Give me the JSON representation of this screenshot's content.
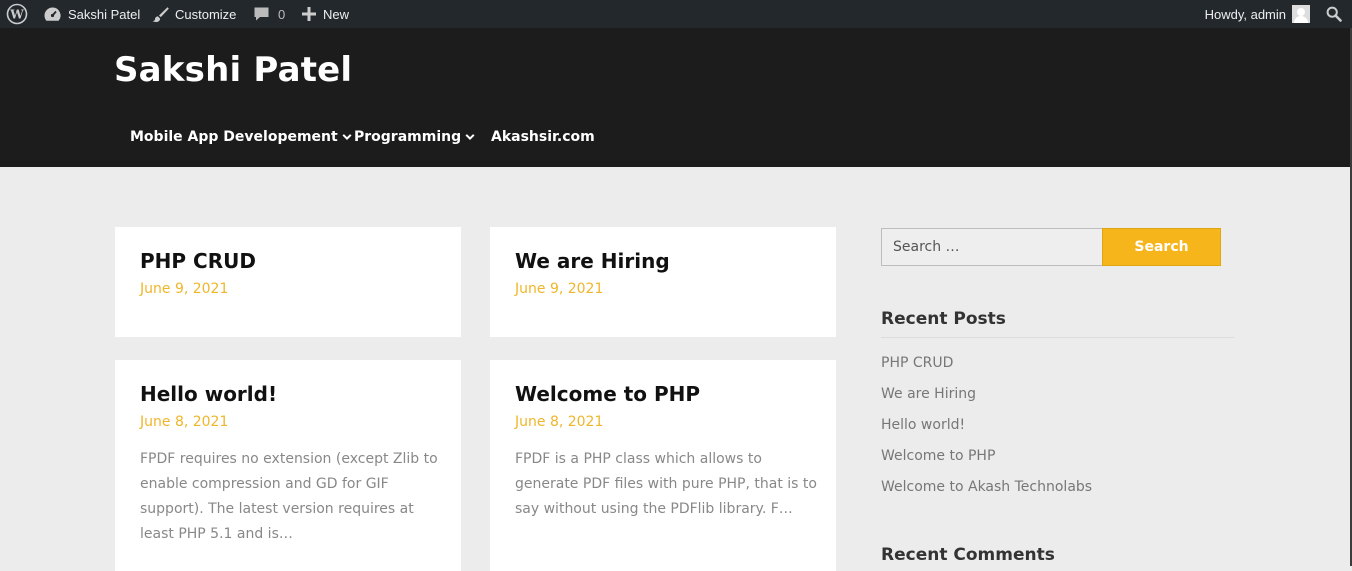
{
  "admin_bar": {
    "site_name": "Sakshi Patel",
    "customize": "Customize",
    "comments_count": "0",
    "new": "New",
    "howdy": "Howdy, admin"
  },
  "header": {
    "site_title": "Sakshi Patel"
  },
  "nav": {
    "items": [
      {
        "label": "Mobile App Developement",
        "has_dropdown": true
      },
      {
        "label": "Programming",
        "has_dropdown": true
      },
      {
        "label": "Akashsir.com",
        "has_dropdown": false
      }
    ]
  },
  "posts": [
    {
      "title": "PHP CRUD",
      "date": "June 9, 2021",
      "excerpt": ""
    },
    {
      "title": "We are Hiring",
      "date": "June 9, 2021",
      "excerpt": ""
    },
    {
      "title": "Hello world!",
      "date": "June 8, 2021",
      "excerpt": "FPDF requires no extension (except Zlib to enable compression and GD for GIF support). The latest version requires at least PHP 5.1 and is…"
    },
    {
      "title": "Welcome to PHP",
      "date": "June 8, 2021",
      "excerpt": "FPDF is a PHP class which allows to generate PDF files with pure PHP, that is to say without using the PDFlib library. F…"
    }
  ],
  "sidebar": {
    "search": {
      "placeholder": "Search …",
      "button_label": "Search"
    },
    "recent_posts_title": "Recent Posts",
    "recent_posts": [
      "PHP CRUD",
      "We are Hiring",
      "Hello world!",
      "Welcome to PHP",
      "Welcome to Akash Technolabs"
    ],
    "recent_comments_title": "Recent Comments"
  },
  "colors": {
    "accent": "#f5b51b",
    "header_bg": "#1c1c1c",
    "admin_bar_bg": "#23282d",
    "page_bg": "#ececec"
  }
}
